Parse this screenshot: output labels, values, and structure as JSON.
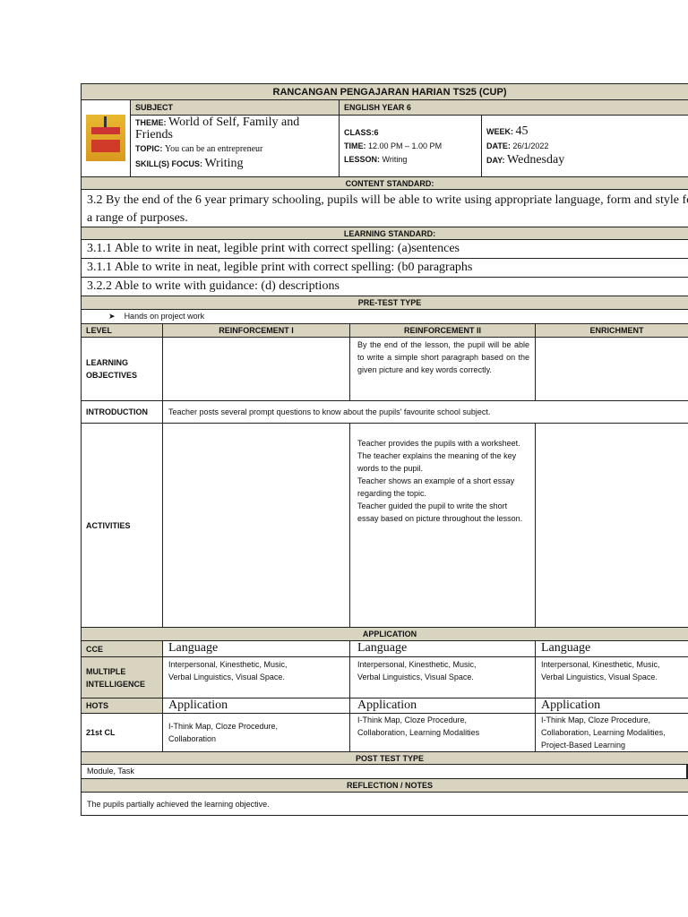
{
  "title": "RANCANGAN PENGAJARAN HARIAN TS25 (CUP)",
  "subject_label": "SUBJECT",
  "subject_value": "ENGLISH YEAR 6",
  "theme_label": "THEME:",
  "theme": "World of Self, Family and Friends",
  "topic_label": "TOPIC:",
  "topic": "You can be an entrepreneur",
  "skill_label": "SKILL(S) FOCUS:",
  "skill": "Writing",
  "class_label": "CLASS:",
  "class": "6",
  "time_label": "TIME:",
  "time": "12.00 PM – 1.00 PM",
  "lesson_label": "LESSON:",
  "lesson": "Writing",
  "week_label": "WEEK:",
  "week": "45",
  "date_label": "DATE:",
  "date": "26/1/2022",
  "day_label": "DAY:",
  "day": "Wednesday",
  "content_standard_header": "CONTENT STANDARD:",
  "content_standard": "3.2 By the end of the 6 year primary schooling, pupils will be able to write using appropriate language, form and style for a range of purposes.",
  "learning_standard_header": "LEARNING STANDARD:",
  "learning_standards": [
    "3.1.1 Able to write in neat, legible print with correct spelling: (a)sentences",
    "3.1.1 Able to write in neat, legible print with correct spelling: (b0 paragraphs",
    "3.2.2 Able to write with guidance: (d) descriptions"
  ],
  "pretest_header": "PRE-TEST TYPE",
  "pretest": "Hands on project work",
  "level_headers": [
    "LEVEL",
    "REINFORCEMENT I",
    "REINFORCEMENT II",
    "ENRICHMENT"
  ],
  "lo_label": "LEARNING OBJECTIVES",
  "lo_r2": "By the end of the lesson, the pupil will be able to write a simple short paragraph based on the given picture and key words correctly.",
  "intro_label": "INTRODUCTION",
  "intro": "Teacher posts several prompt questions to know about the pupils’ favourite school subject.",
  "activities_label": "ACTIVITIES",
  "activities_r2": [
    "Teacher provides the pupils with a worksheet.",
    "The teacher explains the meaning of the key words to the pupil.",
    "Teacher shows an example of a short essay regarding the topic.",
    "Teacher guided the pupil to write the short essay based on picture throughout the lesson."
  ],
  "application_header": "APPLICATION",
  "cce_label": "CCE",
  "cce": [
    "Language",
    "Language",
    "Language"
  ],
  "mi_label": "MULTIPLE INTELLIGENCE",
  "mi": [
    "Interpersonal, Kinesthetic, Music, Verbal Linguistics, Visual Space.",
    "Interpersonal, Kinesthetic, Music, Verbal Linguistics, Visual Space.",
    "Interpersonal, Kinesthetic, Music, Verbal Linguistics, Visual Space."
  ],
  "hots_label": "HOTS",
  "hots": [
    "Application",
    "Application",
    "Application"
  ],
  "cl_label": "21st CL",
  "cl": [
    "I-Think Map, Cloze Procedure, Collaboration",
    "I-Think Map, Cloze Procedure, Collaboration, Learning Modalities",
    "I-Think Map, Cloze Procedure, Collaboration, Learning Modalities, Project-Based Learning"
  ],
  "posttest_header": "POST TEST TYPE",
  "posttest": "Module, Task",
  "reflection_header": "REFLECTION / NOTES",
  "reflection": "The pupils partially achieved the learning objective.",
  "colors": {
    "header_bg": "#d8d4c0"
  }
}
